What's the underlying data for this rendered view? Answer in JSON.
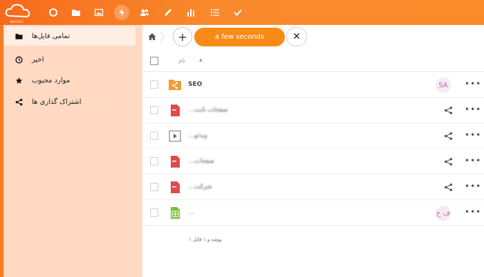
{
  "header": {
    "brand_sub": "NEXSOU",
    "apps": [
      {
        "icon": "circle-icon"
      },
      {
        "icon": "folder-icon"
      },
      {
        "icon": "image-icon"
      },
      {
        "icon": "activity-icon"
      },
      {
        "icon": "contacts-icon"
      },
      {
        "icon": "pencil-icon"
      },
      {
        "icon": "bar-chart-icon"
      },
      {
        "icon": "tasks-icon"
      },
      {
        "icon": "checkmark-icon"
      }
    ]
  },
  "sidebar": {
    "items": [
      {
        "label": "تمامی فایل‌ها",
        "icon": "folder-icon"
      },
      {
        "label": "اخیر",
        "icon": "clock-icon"
      },
      {
        "label": "موارد محبوب",
        "icon": "star-icon"
      },
      {
        "label": "اشتراک گذاری ها",
        "icon": "share-icon"
      }
    ]
  },
  "toolbar": {
    "add_label": "+",
    "upload_status": "a few seconds",
    "upload_progress_fraction": 0.0,
    "cancel_label": "✕"
  },
  "list": {
    "column_name": "نام",
    "rows": [
      {
        "name": "SEO",
        "type": "shared-folder",
        "avatar": "SA"
      },
      {
        "name": "…صفحات ثابت",
        "type": "pdf",
        "shared": true
      },
      {
        "name": "…ویدئو",
        "type": "video",
        "shared": true
      },
      {
        "name": "…صفحات",
        "type": "pdf",
        "shared": true
      },
      {
        "name": "…شرکت",
        "type": "pdf",
        "shared": true
      },
      {
        "name": "…",
        "type": "spreadsheet",
        "avatar": "ف ح"
      }
    ],
    "summary": "پوشه و ۱ فایل ۱"
  },
  "colors": {
    "accent": "#f87d22",
    "sidebar_bg": "#ffd9c2",
    "avatar_text": "#c06aa9"
  }
}
